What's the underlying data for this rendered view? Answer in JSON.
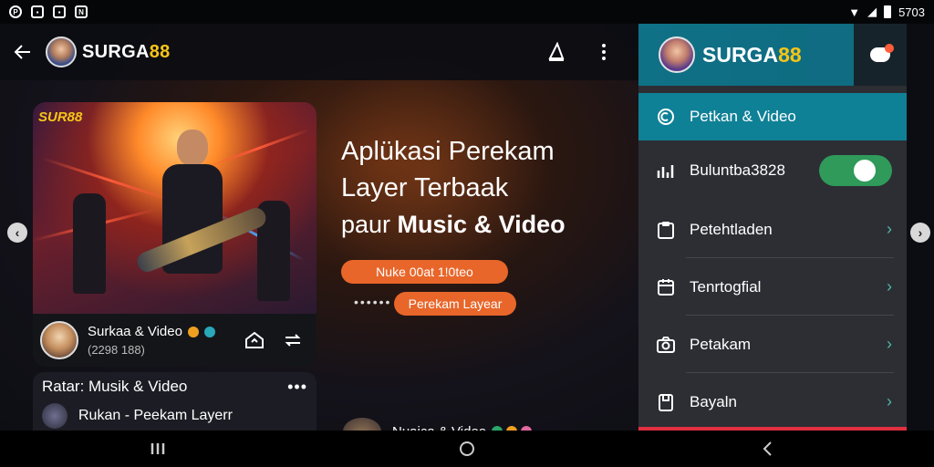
{
  "status_bar": {
    "left_icons": [
      "p-circle-icon",
      "photo-icon",
      "notification-icon",
      "app-n-icon"
    ],
    "time": "5703"
  },
  "app_bar": {
    "brand_main": "SURGA",
    "brand_accent": "88"
  },
  "hero": {
    "tag": "SUR88",
    "meta_title": "Surkaa & Video",
    "meta_sub": "(2298 188)"
  },
  "list_card": {
    "header": "Ratar:  Musik & Video",
    "more": "•••",
    "row_label": "Rukan - Peekam Layerr"
  },
  "headline": {
    "line1": "Aplükasi Perekam",
    "line2": "Layer Terbaak",
    "line3_prefix": "paur ",
    "line3_bold": "Music & Video"
  },
  "chips": {
    "primary": "Nuke 00at 1!0teo",
    "dots": "••••••",
    "secondary": "Perekam Layear"
  },
  "bottom_item": {
    "label": "Nuaica & Video"
  },
  "side_panel": {
    "brand_main": "SURGA",
    "brand_accent": "88",
    "items": [
      {
        "label": "Petkan & Video",
        "active": true
      },
      {
        "label": "Buluntba3828",
        "toggle": true
      },
      {
        "label": "Petehtladen"
      },
      {
        "label": "Tenrtogfial"
      },
      {
        "label": "Petakam"
      },
      {
        "label": "Bayaln"
      }
    ]
  },
  "colors": {
    "accent_yellow": "#f5c518",
    "panel_teal": "#0f8196",
    "chip_orange": "#e8662a",
    "toggle_green": "#2f9a5a"
  }
}
